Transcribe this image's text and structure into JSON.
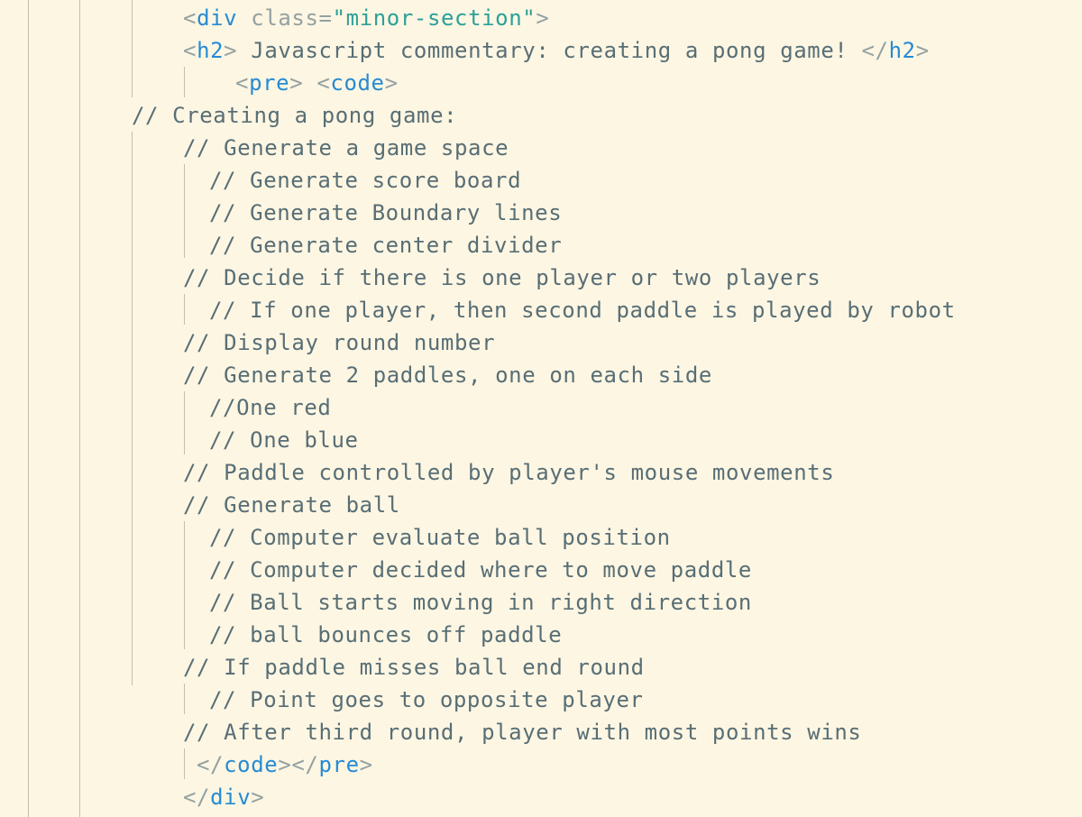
{
  "editor": {
    "lines": [
      {
        "indent": 203,
        "tokens": [
          {
            "t": "<",
            "c": "punct"
          },
          {
            "t": "div",
            "c": "tag"
          },
          {
            "t": " ",
            "c": "text"
          },
          {
            "t": "class",
            "c": "attr"
          },
          {
            "t": "=",
            "c": "punct"
          },
          {
            "t": "\"minor-section\"",
            "c": "str"
          },
          {
            "t": ">",
            "c": "punct"
          }
        ]
      },
      {
        "indent": 203,
        "tokens": [
          {
            "t": "<",
            "c": "punct"
          },
          {
            "t": "h2",
            "c": "tag"
          },
          {
            "t": ">",
            "c": "punct"
          },
          {
            "t": " Javascript commentary: creating a pong game! ",
            "c": "text"
          },
          {
            "t": "</",
            "c": "punct"
          },
          {
            "t": "h2",
            "c": "tag"
          },
          {
            "t": ">",
            "c": "punct"
          }
        ]
      },
      {
        "indent": 261,
        "tokens": [
          {
            "t": "<",
            "c": "punct"
          },
          {
            "t": "pre",
            "c": "tag"
          },
          {
            "t": "> ",
            "c": "punct"
          },
          {
            "t": "<",
            "c": "punct"
          },
          {
            "t": "code",
            "c": "tag"
          },
          {
            "t": ">",
            "c": "punct"
          }
        ]
      },
      {
        "indent": 146,
        "tokens": [
          {
            "t": "// Creating a pong game:",
            "c": "comment"
          }
        ]
      },
      {
        "indent": 203,
        "tokens": [
          {
            "t": "// Generate a game space",
            "c": "comment"
          }
        ]
      },
      {
        "indent": 232,
        "tokens": [
          {
            "t": "// Generate score board",
            "c": "comment"
          }
        ]
      },
      {
        "indent": 232,
        "tokens": [
          {
            "t": "// Generate Boundary lines",
            "c": "comment"
          }
        ]
      },
      {
        "indent": 232,
        "tokens": [
          {
            "t": "// Generate center divider",
            "c": "comment"
          }
        ]
      },
      {
        "indent": 203,
        "tokens": [
          {
            "t": "// Decide if there is one player or two players",
            "c": "comment"
          }
        ]
      },
      {
        "indent": 232,
        "tokens": [
          {
            "t": "// If one player, then second paddle is played by robot",
            "c": "comment"
          }
        ]
      },
      {
        "indent": 203,
        "tokens": [
          {
            "t": "// Display round number",
            "c": "comment"
          }
        ]
      },
      {
        "indent": 203,
        "tokens": [
          {
            "t": "// Generate 2 paddles, one on each side",
            "c": "comment"
          }
        ]
      },
      {
        "indent": 232,
        "tokens": [
          {
            "t": "//One red",
            "c": "comment"
          }
        ]
      },
      {
        "indent": 232,
        "tokens": [
          {
            "t": "// One blue",
            "c": "comment"
          }
        ]
      },
      {
        "indent": 203,
        "tokens": [
          {
            "t": "// Paddle controlled by player's mouse movements",
            "c": "comment"
          }
        ]
      },
      {
        "indent": 203,
        "tokens": [
          {
            "t": "// Generate ball",
            "c": "comment"
          }
        ]
      },
      {
        "indent": 232,
        "tokens": [
          {
            "t": "// Computer evaluate ball position",
            "c": "comment"
          }
        ]
      },
      {
        "indent": 232,
        "tokens": [
          {
            "t": "// Computer decided where to move paddle",
            "c": "comment"
          }
        ]
      },
      {
        "indent": 232,
        "tokens": [
          {
            "t": "// Ball starts moving in right direction",
            "c": "comment"
          }
        ]
      },
      {
        "indent": 232,
        "tokens": [
          {
            "t": "// ball bounces off paddle",
            "c": "comment"
          }
        ]
      },
      {
        "indent": 203,
        "tokens": [
          {
            "t": "// If paddle misses ball end round",
            "c": "comment"
          }
        ]
      },
      {
        "indent": 232,
        "tokens": [
          {
            "t": "// Point goes to opposite player",
            "c": "comment"
          }
        ]
      },
      {
        "indent": 203,
        "tokens": [
          {
            "t": "// After third round, player with most points wins",
            "c": "comment"
          }
        ]
      },
      {
        "indent": 218,
        "tokens": [
          {
            "t": "</",
            "c": "punct"
          },
          {
            "t": "code",
            "c": "tag"
          },
          {
            "t": "></",
            "c": "punct"
          },
          {
            "t": "pre",
            "c": "tag"
          },
          {
            "t": ">",
            "c": "punct"
          }
        ]
      },
      {
        "indent": 203,
        "tokens": [
          {
            "t": "</",
            "c": "punct"
          },
          {
            "t": "div",
            "c": "tag"
          },
          {
            "t": ">",
            "c": "punct"
          }
        ]
      }
    ]
  },
  "theme": {
    "background": "#fdf6e3",
    "text": "#586e75",
    "tag": "#268bd2",
    "string": "#2aa198",
    "punctuation": "#93a1a1",
    "indent_guide": "#c4bfa8"
  }
}
